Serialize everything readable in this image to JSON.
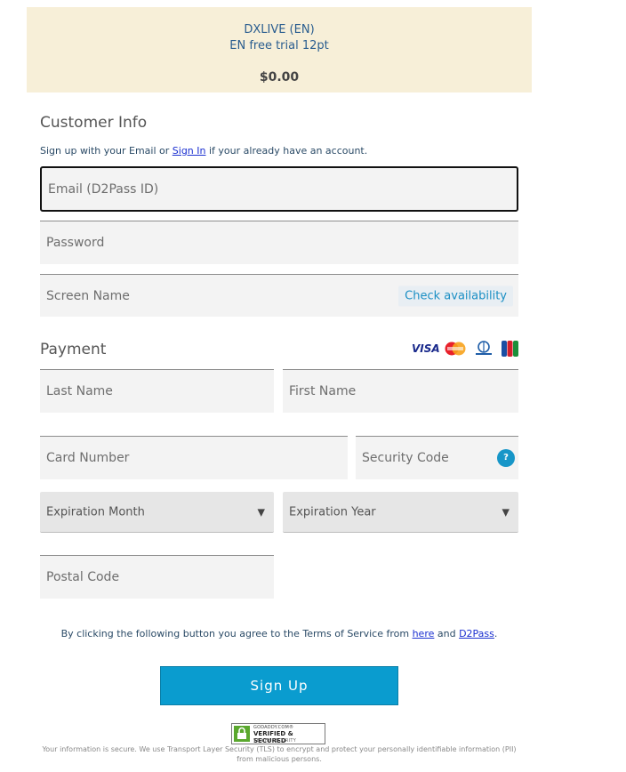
{
  "banner": {
    "product": "DXLIVE (EN)",
    "plan": "EN free trial 12pt",
    "price": "$0.00"
  },
  "customer_info": {
    "title": "Customer Info",
    "signin_prefix": "Sign up with your Email or ",
    "signin_link": "Sign In",
    "signin_suffix": " if your already have an account.",
    "email_placeholder": "Email (D2Pass ID)",
    "password_placeholder": "Password",
    "screen_name_placeholder": "Screen Name",
    "check_availability": "Check availability"
  },
  "payment": {
    "title": "Payment",
    "card_brands": [
      "VISA",
      "MasterCard",
      "Diners Club",
      "JCB"
    ],
    "last_name_placeholder": "Last Name",
    "first_name_placeholder": "First Name",
    "card_number_placeholder": "Card Number",
    "security_code_placeholder": "Security Code",
    "security_help": "?",
    "expiration_month": "Expiration Month",
    "expiration_year": "Expiration Year",
    "postal_code_placeholder": "Postal Code"
  },
  "terms": {
    "prefix": "By clicking the following button you agree to the Terms of Service from ",
    "link1": "here",
    "middle": " and ",
    "link2": "D2Pass",
    "suffix": "."
  },
  "signup_button": "Sign Up",
  "security_badge": {
    "brand": "GODADDY.COM®",
    "verified": "VERIFIED & SECURED",
    "sub": "VERIFY SECURITY"
  },
  "secure_note": "Your information is secure. We use Transport Layer Security (TLS) to encrypt and protect your personally identifiable information (PII) from malicious persons.",
  "colors": {
    "banner_bg": "#f7efd8",
    "accent": "#0a9ccf",
    "link": "#1a2fd0"
  }
}
